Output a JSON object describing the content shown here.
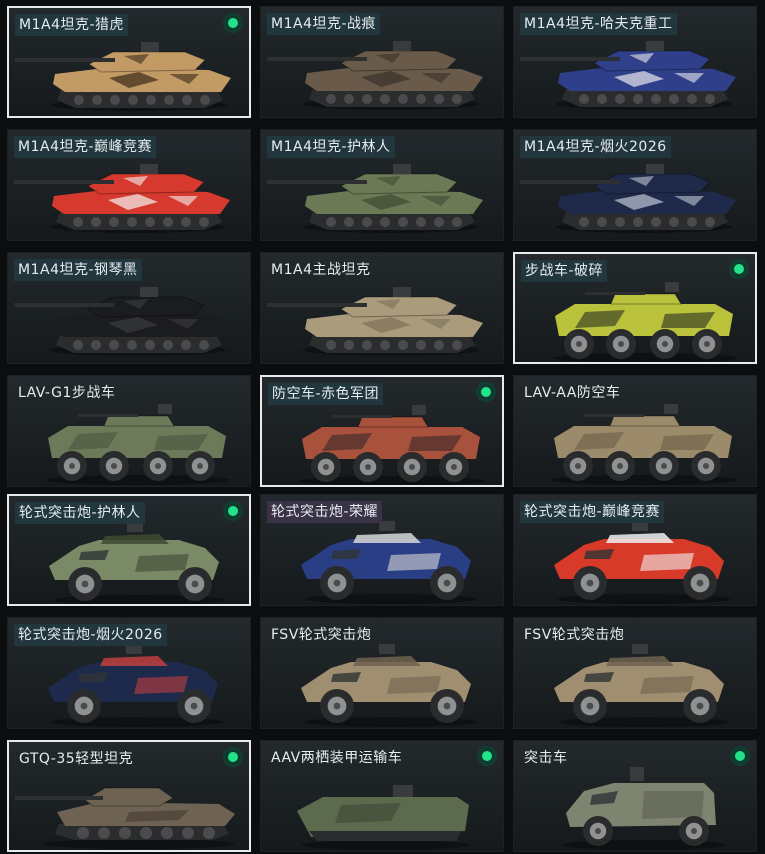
{
  "vehicles": [
    {
      "name": "M1A4坦克-猎虎",
      "kind": "tank",
      "owned": true,
      "selected": true,
      "label_bg": "teal",
      "color": "#c29a64",
      "accent": "#3a2a1a"
    },
    {
      "name": "M1A4坦克-战痕",
      "kind": "tank",
      "owned": false,
      "selected": false,
      "label_bg": "teal",
      "color": "#6a5a4a",
      "accent": "#3a3028"
    },
    {
      "name": "M1A4坦克-哈夫克重工",
      "kind": "tank",
      "owned": false,
      "selected": false,
      "label_bg": "teal",
      "color": "#2f3f8a",
      "accent": "#e8e8ee"
    },
    {
      "name": "M1A4坦克-巅峰竞赛",
      "kind": "tank",
      "owned": false,
      "selected": false,
      "label_bg": "teal",
      "color": "#d63a2e",
      "accent": "#f2f2f2"
    },
    {
      "name": "M1A4坦克-护林人",
      "kind": "tank",
      "owned": false,
      "selected": false,
      "label_bg": "teal",
      "color": "#6b7a55",
      "accent": "#3d4a32"
    },
    {
      "name": "M1A4坦克-烟火2026",
      "kind": "tank",
      "owned": false,
      "selected": false,
      "label_bg": "teal",
      "color": "#1f2a4a",
      "accent": "#c0c6d6"
    },
    {
      "name": "M1A4坦克-钢琴黑",
      "kind": "tank",
      "owned": false,
      "selected": false,
      "label_bg": "teal",
      "color": "#1b1c1e",
      "accent": "#3a3c40"
    },
    {
      "name": "M1A4主战坦克",
      "kind": "tank",
      "owned": false,
      "selected": false,
      "label_bg": "none",
      "color": "#a99b7c",
      "accent": "#7d7159"
    },
    {
      "name": "步战车-破碎",
      "kind": "ifv",
      "owned": true,
      "selected": true,
      "label_bg": "teal",
      "color": "#b9c23a",
      "accent": "#2b2e22"
    },
    {
      "name": "LAV-G1步战车",
      "kind": "ifv",
      "owned": false,
      "selected": false,
      "label_bg": "none",
      "color": "#6d7a5a",
      "accent": "#4a5540"
    },
    {
      "name": "防空车-赤色军团",
      "kind": "ifv",
      "owned": true,
      "selected": true,
      "label_bg": "teal",
      "color": "#a8513d",
      "accent": "#3a2a28"
    },
    {
      "name": "LAV-AA防空车",
      "kind": "ifv",
      "owned": false,
      "selected": false,
      "label_bg": "none",
      "color": "#9c8b6a",
      "accent": "#6a5e48"
    },
    {
      "name": "轮式突击炮-护林人",
      "kind": "wheeled",
      "owned": true,
      "selected": true,
      "label_bg": "teal",
      "color": "#7a8a66",
      "accent": "#3e4a34"
    },
    {
      "name": "轮式突击炮-荣耀",
      "kind": "wheeled",
      "owned": false,
      "selected": false,
      "label_bg": "purple",
      "color": "#2a3e86",
      "accent": "#d8d8d8"
    },
    {
      "name": "轮式突击炮-巅峰竞赛",
      "kind": "wheeled",
      "owned": false,
      "selected": false,
      "label_bg": "teal",
      "color": "#d83a2a",
      "accent": "#f0f0f0"
    },
    {
      "name": "轮式突击炮-烟火2026",
      "kind": "wheeled",
      "owned": false,
      "selected": false,
      "label_bg": "teal",
      "color": "#1e2a4c",
      "accent": "#c04040"
    },
    {
      "name": "FSV轮式突击炮",
      "kind": "wheeled",
      "owned": false,
      "selected": false,
      "label_bg": "none",
      "color": "#a08e70",
      "accent": "#6f634f"
    },
    {
      "name": "FSV轮式突击炮",
      "kind": "wheeled",
      "owned": false,
      "selected": false,
      "label_bg": "none",
      "color": "#a08e70",
      "accent": "#6f634f"
    },
    {
      "name": "GTQ-35轻型坦克",
      "kind": "light_tank",
      "owned": true,
      "selected": true,
      "label_bg": "none",
      "color": "#6e6353",
      "accent": "#4a4034"
    },
    {
      "name": "AAV两栖装甲运输车",
      "kind": "amphibious",
      "owned": true,
      "selected": false,
      "label_bg": "none",
      "color": "#5c6b4e",
      "accent": "#3c4634"
    },
    {
      "name": "突击车",
      "kind": "assault",
      "owned": true,
      "selected": false,
      "label_bg": "none",
      "color": "#7f8470",
      "accent": "#51554a"
    }
  ]
}
